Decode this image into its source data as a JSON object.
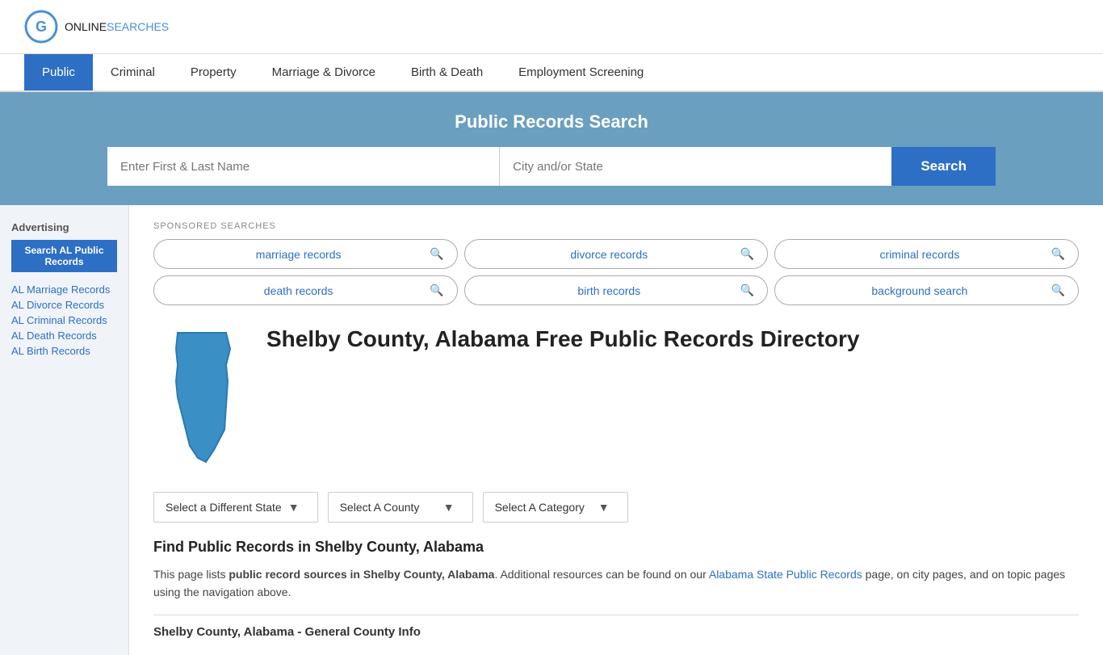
{
  "header": {
    "logo_online": "ONLINE",
    "logo_searches": "SEARCHES"
  },
  "nav": {
    "items": [
      {
        "label": "Public",
        "active": true
      },
      {
        "label": "Criminal",
        "active": false
      },
      {
        "label": "Property",
        "active": false
      },
      {
        "label": "Marriage & Divorce",
        "active": false
      },
      {
        "label": "Birth & Death",
        "active": false
      },
      {
        "label": "Employment Screening",
        "active": false
      }
    ]
  },
  "search_banner": {
    "title": "Public Records Search",
    "name_placeholder": "Enter First & Last Name",
    "location_placeholder": "City and/or State",
    "button_label": "Search"
  },
  "sponsored": {
    "label": "SPONSORED SEARCHES",
    "pills": [
      {
        "text": "marriage records"
      },
      {
        "text": "divorce records"
      },
      {
        "text": "criminal records"
      },
      {
        "text": "death records"
      },
      {
        "text": "birth records"
      },
      {
        "text": "background search"
      }
    ]
  },
  "county": {
    "title": "Shelby County, Alabama Free Public Records Directory"
  },
  "dropdowns": {
    "state_label": "Select a Different State",
    "county_label": "Select A County",
    "category_label": "Select A Category"
  },
  "content": {
    "find_title": "Find Public Records in Shelby County, Alabama",
    "find_desc_part1": "This page lists ",
    "find_desc_bold": "public record sources in Shelby County, Alabama",
    "find_desc_part2": ". Additional resources can be found on our ",
    "find_desc_link": "Alabama State Public Records",
    "find_desc_part3": " page, on city pages, and on topic pages using the navigation above.",
    "general_info_title": "Shelby County, Alabama - General County Info"
  },
  "sidebar": {
    "advertising_label": "Advertising",
    "ad_button": "Search AL Public Records",
    "links": [
      {
        "text": "AL Marriage Records"
      },
      {
        "text": "AL Divorce Records"
      },
      {
        "text": "AL Criminal Records"
      },
      {
        "text": "AL Death Records"
      },
      {
        "text": "AL Birth Records"
      }
    ]
  }
}
